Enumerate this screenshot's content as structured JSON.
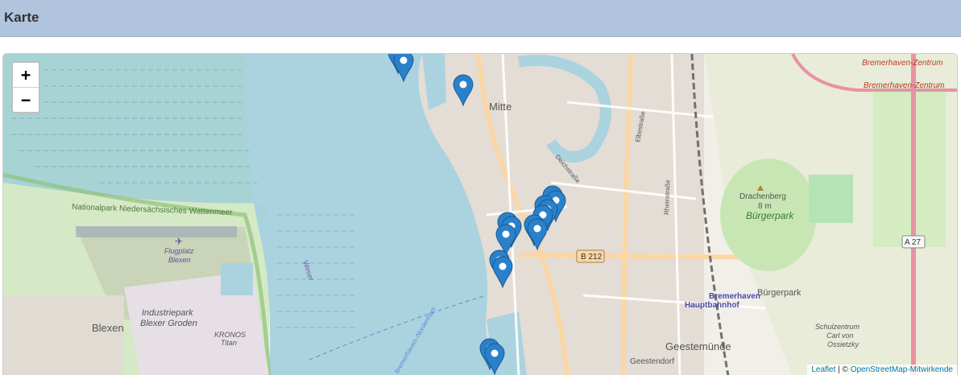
{
  "header": {
    "title": "Karte"
  },
  "map": {
    "zoom_in_label": "+",
    "zoom_out_label": "−",
    "attribution": {
      "leaflet": "Leaflet",
      "separator": " | © ",
      "osm": "OpenStreetMap-Mitwirkende"
    },
    "labels": {
      "mitte": "Mitte",
      "nationalpark": "Nationalpark Niedersächsisches Wattenmeer",
      "flugplatz_1": "Flugplatz",
      "flugplatz_2": "Blexen",
      "industriepark_1": "Industriepark",
      "industriepark_2": "Blexer Groden",
      "blexen": "Blexen",
      "kronos_1": "KRONOS",
      "kronos_2": "Titan",
      "bremerhaven_zentrum_1": "Bremerhaven-Zentrum",
      "bremerhaven_zentrum_2": "Bremerhaven-Zentrum",
      "drachenberg": "Drachenberg",
      "drachenberg_height": "8 m",
      "buergerpark_1": "Bürgerpark",
      "buergerpark_2": "Bürgerpark",
      "hbf_1": "Bremerhaven",
      "hbf_2": "Hauptbahnhof",
      "b212": "B 212",
      "a27": "A 27",
      "schulzentrum_1": "Schulzentrum",
      "schulzentrum_2": "Carl von",
      "schulzentrum_3": "Ossietzky",
      "geestemuende": "Geestemünde",
      "geestendorf": "Geestendorf",
      "elbestrasse": "Elbestraße",
      "rheinstrasse": "Rheinstraße",
      "deichstrasse": "Deichstraße",
      "ferry": "Bremerhaven–Nordenham",
      "weser": "Weser"
    },
    "marker_count": 17,
    "colors": {
      "water": "#aad3df",
      "marker": "#2a81cb",
      "park": "#c8e6b4",
      "header": "#b0c4de"
    }
  }
}
